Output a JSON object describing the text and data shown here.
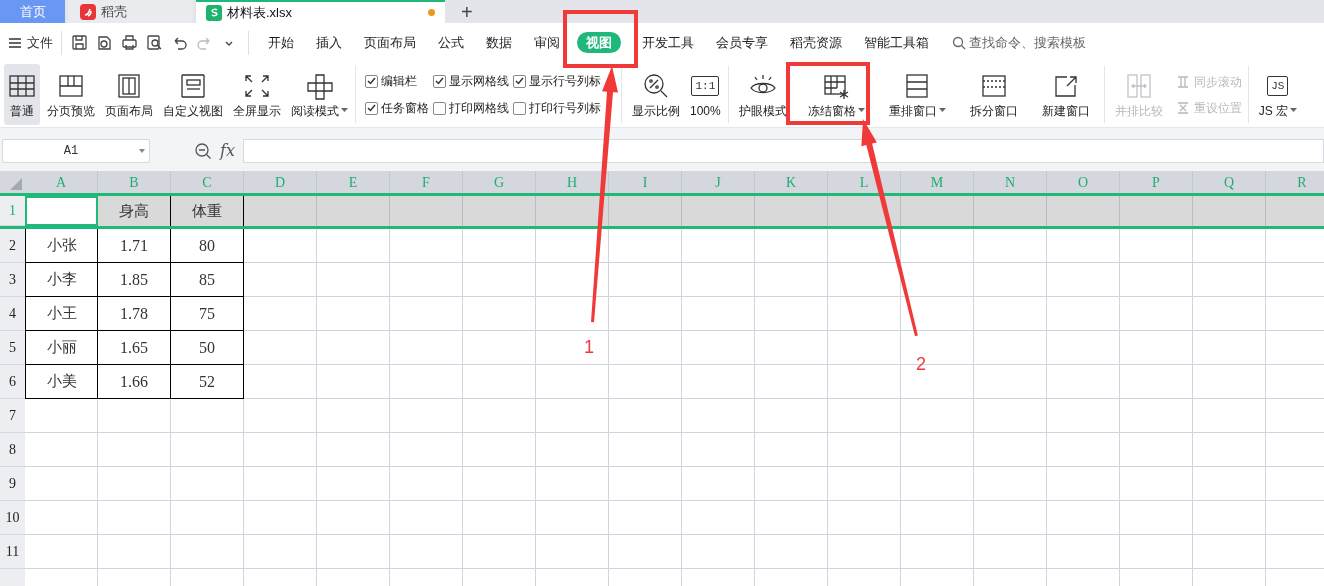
{
  "doc_tabs": [
    {
      "label": "首页",
      "kind": "home",
      "selected": false
    },
    {
      "label": "稻壳",
      "kind": "docer",
      "selected": false
    },
    {
      "label": "材料表.xlsx",
      "kind": "sheet",
      "selected": true,
      "modified": true
    }
  ],
  "new_tab_label": "+",
  "menu": {
    "file_label": "文件",
    "tabs": [
      {
        "label": "开始",
        "selected": false
      },
      {
        "label": "插入",
        "selected": false
      },
      {
        "label": "页面布局",
        "selected": false
      },
      {
        "label": "公式",
        "selected": false
      },
      {
        "label": "数据",
        "selected": false
      },
      {
        "label": "审阅",
        "selected": false
      },
      {
        "label": "视图",
        "selected": true
      },
      {
        "label": "开发工具",
        "selected": false
      },
      {
        "label": "会员专享",
        "selected": false
      },
      {
        "label": "稻壳资源",
        "selected": false
      },
      {
        "label": "智能工具箱",
        "selected": false
      }
    ],
    "search_placeholder": "查找命令、搜索模板"
  },
  "ribbon": {
    "groups": [
      {
        "kind": "large",
        "divider_after": true,
        "items": [
          {
            "label": "普通",
            "selected": true,
            "dropdown": false
          },
          {
            "label": "分页预览",
            "selected": false,
            "dropdown": false
          },
          {
            "label": "页面布局",
            "selected": false,
            "dropdown": false
          },
          {
            "label": "自定义视图",
            "selected": false,
            "dropdown": false
          },
          {
            "label": "全屏显示",
            "selected": false,
            "dropdown": false
          },
          {
            "label": "阅读模式",
            "selected": false,
            "dropdown": true
          }
        ]
      },
      {
        "kind": "checks",
        "divider_after": true,
        "items": [
          {
            "label": "编辑栏",
            "checked": true
          },
          {
            "label": "显示网格线",
            "checked": true
          },
          {
            "label": "显示行号列标",
            "checked": true
          },
          {
            "label": "任务窗格",
            "checked": true
          },
          {
            "label": "打印网格线",
            "checked": false
          },
          {
            "label": "打印行号列标",
            "checked": false
          }
        ]
      },
      {
        "kind": "large",
        "divider_after": true,
        "items": [
          {
            "label": "显示比例",
            "dropdown": false
          },
          {
            "label": "100%",
            "dropdown": false,
            "icon_text": "1:1"
          }
        ]
      },
      {
        "kind": "large",
        "divider_after": false,
        "items": [
          {
            "label": "护眼模式",
            "dropdown": false
          }
        ]
      },
      {
        "kind": "large",
        "divider_after": true,
        "items": [
          {
            "label": "冻结窗格",
            "dropdown": true
          },
          {
            "label": "重排窗口",
            "dropdown": true
          },
          {
            "label": "拆分窗口",
            "dropdown": false
          },
          {
            "label": "新建窗口",
            "dropdown": false
          }
        ]
      },
      {
        "kind": "large",
        "divider_after": false,
        "items": [
          {
            "label": "并排比较",
            "dropdown": false,
            "disabled": true
          }
        ]
      },
      {
        "kind": "small",
        "divider_after": true,
        "items": [
          {
            "label": "同步滚动",
            "disabled": true
          },
          {
            "label": "重设位置",
            "disabled": true
          }
        ]
      },
      {
        "kind": "large",
        "divider_after": false,
        "items": [
          {
            "label": "JS 宏",
            "dropdown": true,
            "icon_text": "JS"
          }
        ]
      }
    ]
  },
  "formula_bar": {
    "name_box": "A1",
    "fx_label": "fx"
  },
  "sheet": {
    "columns": [
      {
        "label": "A",
        "selected": true
      },
      {
        "label": "B",
        "selected": true
      },
      {
        "label": "C",
        "selected": true
      },
      {
        "label": "D",
        "selected": true
      },
      {
        "label": "E",
        "selected": true
      },
      {
        "label": "F",
        "selected": true
      },
      {
        "label": "G",
        "selected": true
      },
      {
        "label": "H",
        "selected": true
      },
      {
        "label": "I",
        "selected": true
      },
      {
        "label": "J",
        "selected": true
      },
      {
        "label": "K",
        "selected": true
      },
      {
        "label": "L",
        "selected": true
      },
      {
        "label": "M",
        "selected": true
      },
      {
        "label": "N",
        "selected": true
      },
      {
        "label": "O",
        "selected": true
      },
      {
        "label": "P",
        "selected": true
      },
      {
        "label": "Q",
        "selected": true
      },
      {
        "label": "R",
        "selected": true
      }
    ],
    "rows": [
      {
        "label": "1",
        "selected": true,
        "frozen": true
      },
      {
        "label": "2",
        "selected": false,
        "frozen": false
      },
      {
        "label": "3",
        "selected": false,
        "frozen": false
      },
      {
        "label": "4",
        "selected": false,
        "frozen": false
      },
      {
        "label": "5",
        "selected": false,
        "frozen": false
      },
      {
        "label": "6",
        "selected": false,
        "frozen": false
      },
      {
        "label": "7",
        "selected": false,
        "frozen": false
      },
      {
        "label": "8",
        "selected": false,
        "frozen": false
      },
      {
        "label": "9",
        "selected": false,
        "frozen": false
      },
      {
        "label": "10",
        "selected": false,
        "frozen": false
      },
      {
        "label": "11",
        "selected": false,
        "frozen": false
      }
    ],
    "table": {
      "headers": [
        "身高",
        "体重"
      ],
      "rows": [
        {
          "name": "小张",
          "values": [
            "1.71",
            "80"
          ]
        },
        {
          "name": "小李",
          "values": [
            "1.85",
            "85"
          ]
        },
        {
          "name": "小王",
          "values": [
            "1.78",
            "75"
          ]
        },
        {
          "name": "小丽",
          "values": [
            "1.65",
            "50"
          ]
        },
        {
          "name": "小美",
          "values": [
            "1.66",
            "52"
          ]
        }
      ]
    }
  },
  "annotations": [
    {
      "label": "1",
      "color": "#f03a3a"
    },
    {
      "label": "2",
      "color": "#f03a3a"
    }
  ]
}
